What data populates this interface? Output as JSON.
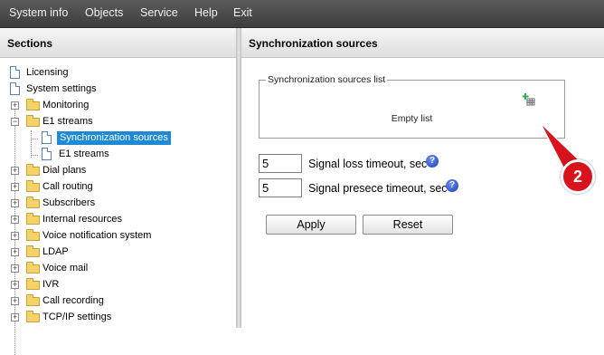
{
  "menu": {
    "items": [
      {
        "label": "System info"
      },
      {
        "label": "Objects"
      },
      {
        "label": "Service"
      },
      {
        "label": "Help"
      },
      {
        "label": "Exit"
      }
    ]
  },
  "sections": {
    "title": "Sections",
    "tree": [
      {
        "label": "Licensing",
        "type": "doc"
      },
      {
        "label": "System settings",
        "type": "doc"
      },
      {
        "label": "Monitoring",
        "type": "folder",
        "expander": "+"
      },
      {
        "label": "E1 streams",
        "type": "folder",
        "expander": "−"
      },
      {
        "label": "Synchronization sources",
        "type": "doc",
        "selected": true
      },
      {
        "label": "E1 streams",
        "type": "doc"
      },
      {
        "label": "Dial plans",
        "type": "folder",
        "expander": "+"
      },
      {
        "label": "Call routing",
        "type": "folder",
        "expander": "+"
      },
      {
        "label": "Subscribers",
        "type": "folder",
        "expander": "+"
      },
      {
        "label": "Internal resources",
        "type": "folder",
        "expander": "+"
      },
      {
        "label": "Voice notification system",
        "type": "folder",
        "expander": "+"
      },
      {
        "label": "LDAP",
        "type": "folder",
        "expander": "+"
      },
      {
        "label": "Voice mail",
        "type": "folder",
        "expander": "+"
      },
      {
        "label": "IVR",
        "type": "folder",
        "expander": "+"
      },
      {
        "label": "Call recording",
        "type": "folder",
        "expander": "+"
      },
      {
        "label": "TCP/IP settings",
        "type": "folder",
        "expander": "+"
      }
    ]
  },
  "main": {
    "title": "Synchronization sources",
    "list": {
      "legend": "Synchronization sources list",
      "empty_text": "Empty list"
    },
    "fields": [
      {
        "value": "5",
        "label": "Signal loss timeout, sec",
        "help": "?"
      },
      {
        "value": "5",
        "label": "Signal presece timeout, sec",
        "help": "?"
      }
    ],
    "apply_label": "Apply",
    "reset_label": "Reset"
  },
  "annotation": {
    "badge": "2",
    "color": "#d8131c"
  }
}
